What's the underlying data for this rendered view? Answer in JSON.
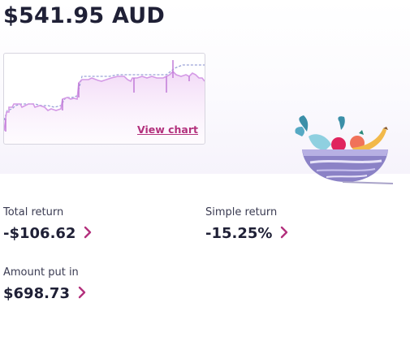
{
  "account": {
    "balance": "$541.95 AUD"
  },
  "chart_card": {
    "link_label": "View chart"
  },
  "stats": {
    "total_return": {
      "label": "Total return",
      "value": "-$106.62"
    },
    "simple_return": {
      "label": "Simple return",
      "value": "-15.25%"
    },
    "amount_put_in": {
      "label": "Amount put in",
      "value": "$698.73"
    }
  },
  "colors": {
    "text": "#1f2036",
    "accent": "#b3317d",
    "chart_line": "#d49ae6",
    "chart_dashed": "#9aa2d8"
  },
  "icons": {
    "illustration": "fruit-bowl-illustration",
    "chevron": "chevron-right-icon"
  }
}
